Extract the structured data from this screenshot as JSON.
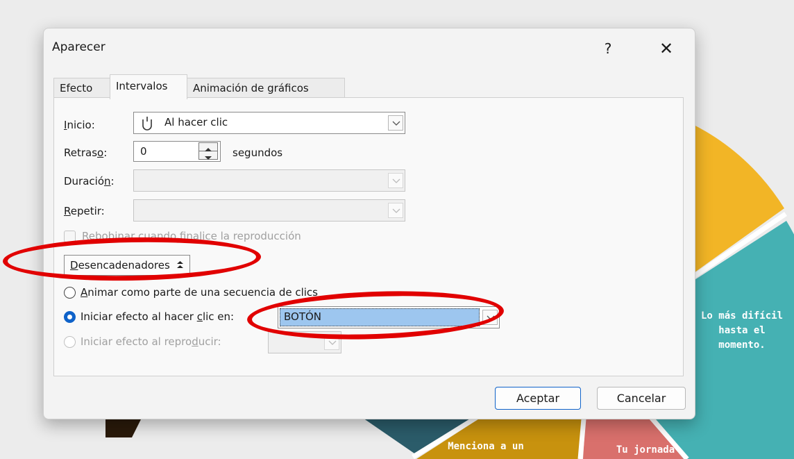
{
  "dialog": {
    "title": "Aparecer",
    "help_symbol": "?",
    "close_symbol": "✕"
  },
  "tabs": [
    {
      "label": "Efecto",
      "active": false
    },
    {
      "label": "Intervalos",
      "active": true
    },
    {
      "label": "Animación de gráficos",
      "active": false
    }
  ],
  "timing": {
    "inicio_label_u": "I",
    "inicio_label_rest": "nicio:",
    "inicio_value": "Al hacer clic",
    "retraso_label_pre": "Retras",
    "retraso_label_u": "o",
    "retraso_label_post": ":",
    "retraso_value": "0",
    "retraso_unit": "segundos",
    "duracion_label_pre": "Duració",
    "duracion_label_u": "n",
    "duracion_label_post": ":",
    "repetir_label_u": "R",
    "repetir_label_rest": "epetir:",
    "rewind_label": "Rebobinar cuando finalice la reproducción"
  },
  "triggers": {
    "button_label_u": "D",
    "button_label_rest": "esencadenadores",
    "button_icon": "collapse-up-icon",
    "option1_u": "A",
    "option1_rest": "nimar como parte de una secuencia de clics",
    "option2_pre": "Iniciar efecto al hacer ",
    "option2_u": "c",
    "option2_post": "lic en:",
    "option2_value": "BOTÓN",
    "option3_pre": "Iniciar efecto al repro",
    "option3_u": "d",
    "option3_post": "ucir:"
  },
  "buttons": {
    "ok": "Aceptar",
    "cancel": "Cancelar"
  },
  "background": {
    "slice_right_text": "Lo más difícil hasta el momento.",
    "slice_bottom_left_text": "Menciona a un",
    "slice_bottom_right_text": "Tu jornada"
  },
  "colors": {
    "accent": "#0f62c9",
    "highlight": "#9dc6ef",
    "annotation": "#e10000",
    "slice_yellow": "#f2b526",
    "slice_teal": "#45b1b3",
    "slice_dark_teal": "#2b5c6a",
    "slice_gold": "#c8920e",
    "slice_red": "#d9706c"
  }
}
